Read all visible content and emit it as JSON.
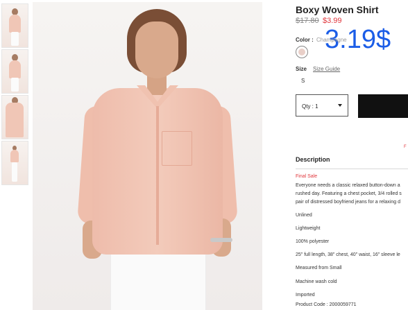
{
  "product": {
    "title": "Boxy Woven Shirt",
    "original_price": "$17.80",
    "sale_price": "$3.99",
    "overlay_price": "3.19$"
  },
  "color": {
    "label": "Color :",
    "value": "Champagne",
    "swatch_color": "#e9cfc8"
  },
  "size": {
    "label": "Size",
    "guide_link": "Size Guide",
    "selected": "S"
  },
  "quantity": {
    "label": "Qty : 1"
  },
  "description": {
    "heading": "Description",
    "final_sale": "Final Sale",
    "paragraph_lines": [
      "Everyone needs a classic relaxed button-down a",
      "rushed day. Featuring a chest pocket, 3/4 rolled s",
      "pair of distressed boyfriend jeans for a relaxing d"
    ],
    "specs": [
      "Unlined",
      "Lightweight",
      "100% polyester",
      "25\" full length, 38\" chest, 40\" waist, 16\" sleeve le",
      "Measured from Small",
      "Machine wash cold",
      "Imported",
      "Product Code : 2000059771"
    ]
  },
  "misc": {
    "tiny_red_text": "F"
  },
  "colors": {
    "price_red": "#e0353b",
    "overlay_blue": "#1b5de7",
    "button_black": "#111111"
  }
}
